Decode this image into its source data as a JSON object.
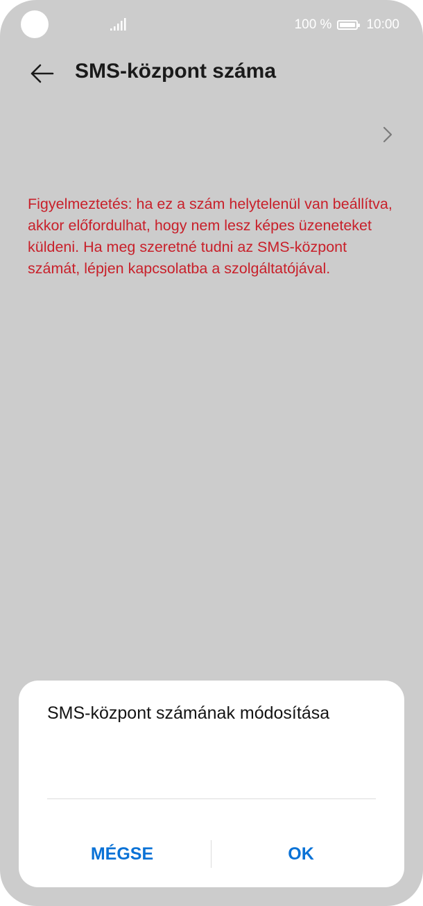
{
  "status_bar": {
    "battery_text": "100 %",
    "time": "10:00",
    "icons": [
      "signal-icon",
      "battery-icon"
    ]
  },
  "header": {
    "back_icon": "arrow-left-icon",
    "title": "SMS-központ száma"
  },
  "sms_center_row": {
    "chevron_icon": "chevron-right-icon"
  },
  "warning": {
    "text": "Figyelmeztetés: ha ez a szám helytelenül van beállítva, akkor előfordulhat, hogy nem lesz képes üzeneteket küldeni. Ha meg szeretné tudni az SMS-központ számát, lépjen kapcsolatba a szolgáltatójával.",
    "color": "#c8202a"
  },
  "dialog": {
    "title": "SMS-központ számának módosítása",
    "input_value": "",
    "cancel_label": "MÉGSE",
    "ok_label": "OK",
    "accent_color": "#0a72d6"
  },
  "colors": {
    "background_dim": "#cccccc",
    "dialog_bg": "#ffffff"
  }
}
